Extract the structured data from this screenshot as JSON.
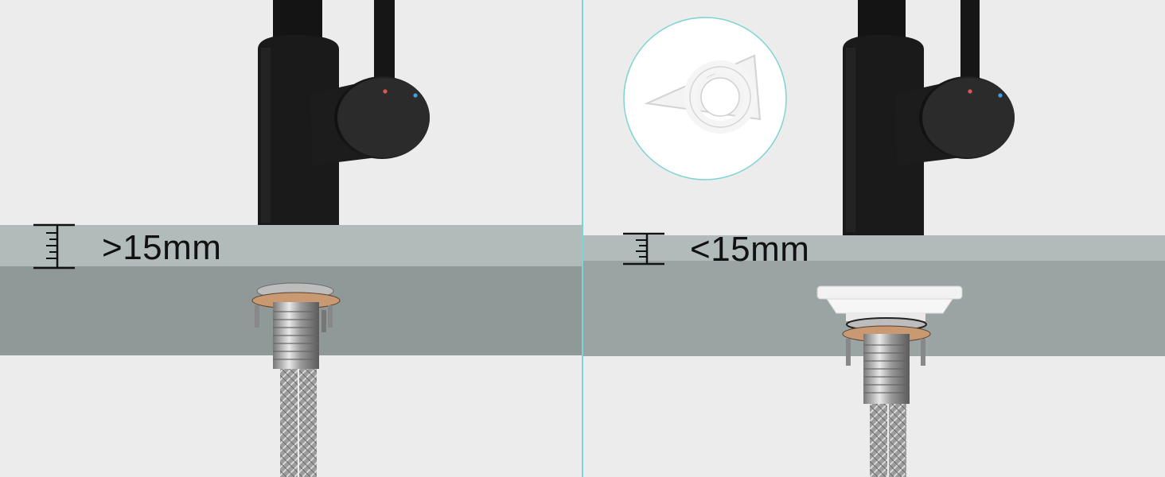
{
  "panels": {
    "left": {
      "thickness_label": ">15mm"
    },
    "right": {
      "thickness_label": "<15mm"
    }
  },
  "colors": {
    "background": "#ececec",
    "counter_top": "#b1bcba",
    "counter_body": "#8f9998",
    "faucet": "#1a1a1a",
    "divider": "#7fd3d2",
    "inset_border": "#7fd3d2"
  },
  "icons": [
    "ruler-depth-icon",
    "hot-indicator-dot",
    "cold-indicator-dot"
  ]
}
